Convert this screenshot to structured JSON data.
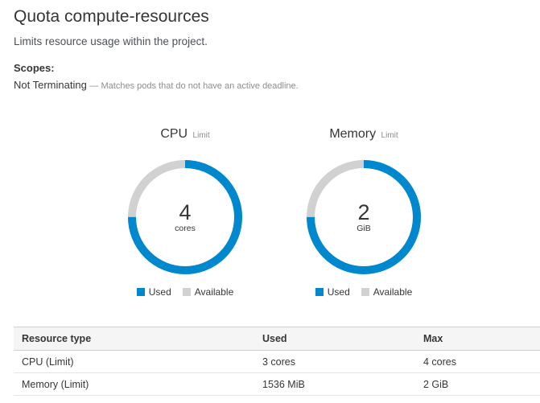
{
  "page": {
    "title": "Quota compute-resources",
    "description": "Limits resource usage within the project."
  },
  "scopes": {
    "heading": "Scopes:",
    "items": [
      {
        "name": "Not Terminating",
        "description": "— Matches pods that do not have an active deadline."
      }
    ]
  },
  "colors": {
    "used": "#0088ce",
    "available": "#d1d1d1"
  },
  "charts": [
    {
      "title": "CPU",
      "subtitle": "Limit",
      "value": "4",
      "unit": "cores",
      "used_fraction": 0.75,
      "legend_used": "Used",
      "legend_available": "Available"
    },
    {
      "title": "Memory",
      "subtitle": "Limit",
      "value": "2",
      "unit": "GiB",
      "used_fraction": 0.75,
      "legend_used": "Used",
      "legend_available": "Available"
    }
  ],
  "table": {
    "headers": [
      "Resource type",
      "Used",
      "Max"
    ],
    "rows": [
      [
        "CPU (Limit)",
        "3 cores",
        "4 cores"
      ],
      [
        "Memory (Limit)",
        "1536 MiB",
        "2 GiB"
      ]
    ]
  }
}
